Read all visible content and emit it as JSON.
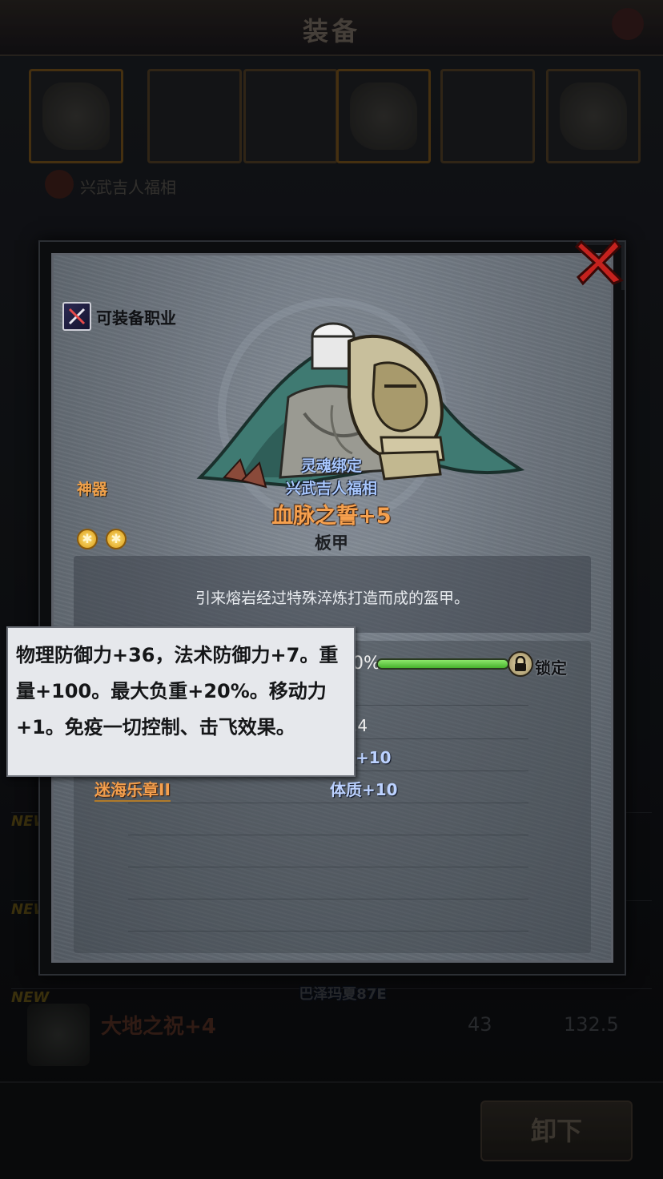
{
  "background": {
    "title": "装备",
    "character_name": "兴武吉人福相",
    "rows": [
      {
        "new_badge": "NEW"
      },
      {
        "new_badge": "NEW"
      },
      {
        "new_badge": "NEW",
        "owner": "巴泽玛夏87E",
        "name": "大地之祝+4",
        "value1": "43",
        "value2": "132.5"
      }
    ],
    "unequip_label": "卸下"
  },
  "detail": {
    "job_label": "可装备职业",
    "category": "神器",
    "star_count": 2,
    "bind_status": "灵魂绑定",
    "owner": "兴武吉人福相",
    "item_name": "血脉之誓+5",
    "item_type": "板甲",
    "description": "引来熔岩经过特殊淬炼打造而成的盔甲。",
    "progress_text": "0%",
    "progress_value": 1.0,
    "lock_label": "锁定",
    "partial_stat": ".4",
    "partial_stat2": "量+10",
    "sub_item_name": "迷海乐章II",
    "sub_item_stat": "体质+10"
  },
  "tooltip": {
    "text": "物理防御力+36，法术防御力+7。重量+100。最大负重+20%。移动力+1。免疫一切控制、击飞效果。"
  },
  "colors": {
    "item_name": "#f5a04e",
    "bind_text": "#a9c8ff",
    "category": "#f0a14a",
    "progress_fill": "#46b22c",
    "close_red": "#c4221e"
  }
}
